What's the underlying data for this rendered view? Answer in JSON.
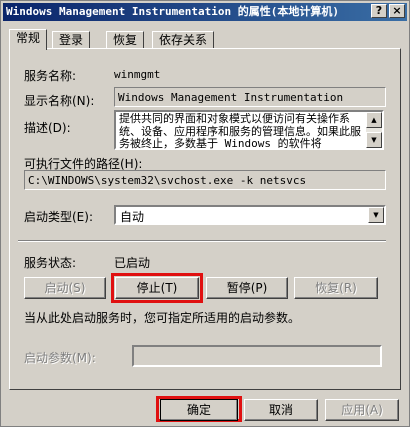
{
  "window": {
    "title": "Windows Management Instrumentation 的属性(本地计算机)",
    "help_label": "?",
    "close_label": "×"
  },
  "tabs": [
    "常规",
    "登录",
    "恢复",
    "依存关系"
  ],
  "general": {
    "service_name_label": "服务名称:",
    "service_name_value": "winmgmt",
    "display_name_label": "显示名称(N):",
    "display_name_value": "Windows Management Instrumentation",
    "description_label": "描述(D):",
    "description_value": "提供共同的界面和对象模式以便访问有关操作系统、设备、应用程序和服务的管理信息。如果此服务被终止，多数基于 Windows 的软件将",
    "path_label": "可执行文件的路径(H):",
    "path_value": "C:\\WINDOWS\\system32\\svchost.exe -k netsvcs",
    "startup_type_label": "启动类型(E):",
    "startup_type_value": "自动",
    "status_label": "服务状态:",
    "status_value": "已启动",
    "hint_text": "当从此处启动服务时，您可指定所适用的启动参数。",
    "params_label": "启动参数(M):"
  },
  "service_buttons": {
    "start": "启动(S)",
    "stop": "停止(T)",
    "pause": "暂停(P)",
    "resume": "恢复(R)"
  },
  "dialog_buttons": {
    "ok": "确定",
    "cancel": "取消",
    "apply": "应用(A)"
  },
  "colors": {
    "highlight": "#e01010",
    "title_gradient_start": "#0a246a",
    "title_gradient_end": "#3a6ea5",
    "face": "#d4d0c8"
  }
}
